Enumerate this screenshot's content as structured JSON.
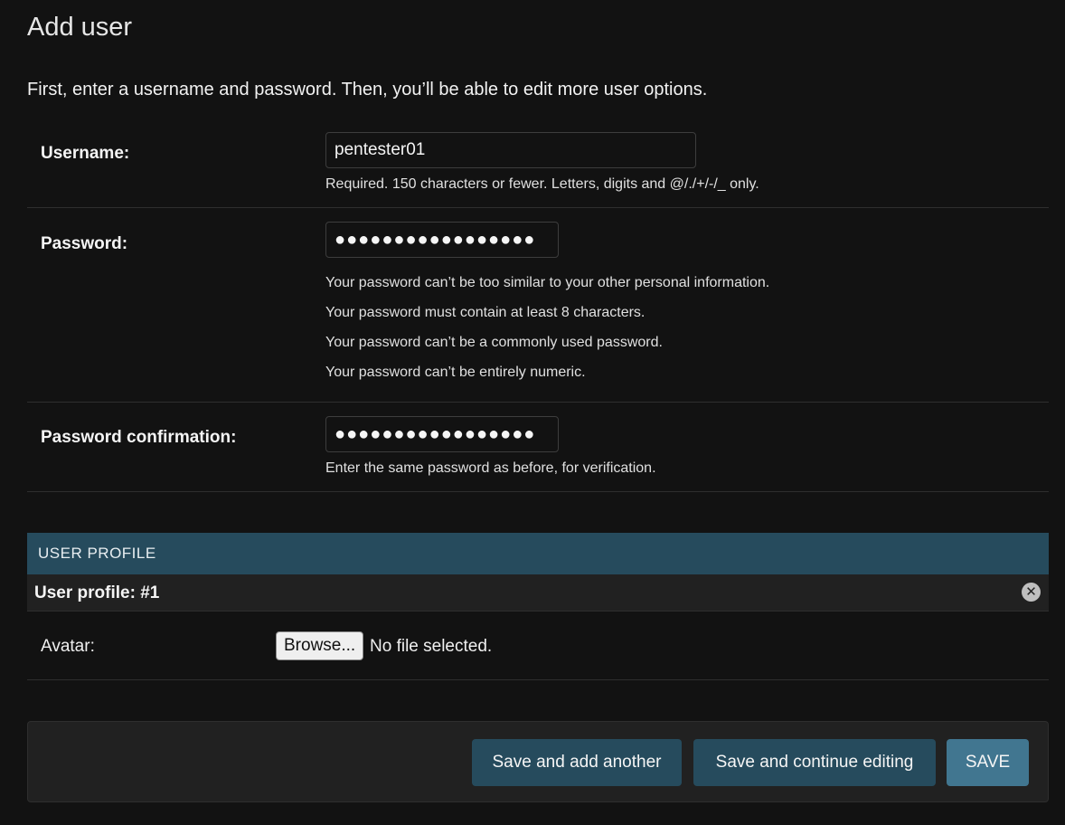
{
  "page": {
    "title": "Add user",
    "intro": "First, enter a username and password. Then, you’ll be able to edit more user options."
  },
  "form": {
    "username": {
      "label": "Username:",
      "value": "pentester01",
      "help": "Required. 150 characters or fewer. Letters, digits and @/./+/-/_ only."
    },
    "password": {
      "label": "Password:",
      "value": "●●●●●●●●●●●●●●●●●",
      "help": [
        "Your password can’t be too similar to your other personal information.",
        "Your password must contain at least 8 characters.",
        "Your password can’t be a commonly used password.",
        "Your password can’t be entirely numeric."
      ]
    },
    "password_confirmation": {
      "label": "Password confirmation:",
      "value": "●●●●●●●●●●●●●●●●●",
      "help": "Enter the same password as before, for verification."
    }
  },
  "inline": {
    "header": "USER PROFILE",
    "item_title": "User profile: #1",
    "delete_icon": "close-circle-icon",
    "avatar": {
      "label": "Avatar:",
      "browse_label": "Browse...",
      "file_status": "No file selected."
    }
  },
  "submit": {
    "save_add_another": "Save and add another",
    "save_continue": "Save and continue editing",
    "save": "SAVE"
  },
  "colors": {
    "background": "#121212",
    "module_header": "#264b5d",
    "button_secondary": "#264b5d",
    "button_primary": "#417690"
  }
}
